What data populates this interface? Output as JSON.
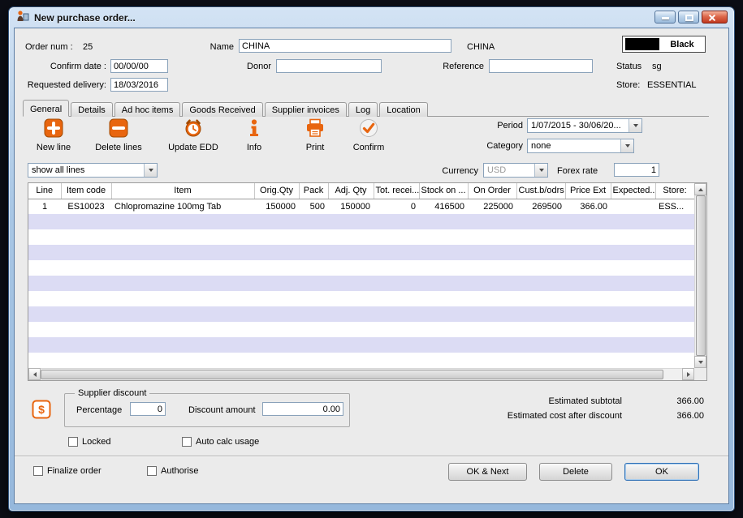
{
  "window": {
    "title": "New purchase order..."
  },
  "header": {
    "order_num_label": "Order num :",
    "order_num_value": "25",
    "name_label": "Name",
    "name_value": "CHINA",
    "name_display": "CHINA",
    "color_label": "Black",
    "confirm_date_label": "Confirm date :",
    "confirm_date_value": "00/00/00",
    "donor_label": "Donor",
    "donor_value": "",
    "reference_label": "Reference",
    "reference_value": "",
    "status_label": "Status",
    "status_value": "sg",
    "requested_delivery_label": "Requested delivery:",
    "requested_delivery_value": "18/03/2016",
    "store_label": "Store:",
    "store_value": "ESSENTIAL"
  },
  "tabs": [
    "General",
    "Details",
    "Ad hoc items",
    "Goods Received",
    "Supplier invoices",
    "Log",
    "Location"
  ],
  "toolbar": {
    "new_line": "New line",
    "delete_lines": "Delete lines",
    "update_edd": "Update EDD",
    "info": "Info",
    "print": "Print",
    "confirm": "Confirm",
    "period_label": "Period",
    "period_value": "1/07/2015 - 30/06/20...",
    "category_label": "Category",
    "category_value": "none"
  },
  "filters": {
    "show_lines_value": "show all lines",
    "currency_label": "Currency",
    "currency_value": "USD",
    "forex_label": "Forex rate",
    "forex_value": "1"
  },
  "table": {
    "columns": [
      "Line",
      "Item code",
      "Item",
      "Orig.Qty",
      "Pack",
      "Adj. Qty",
      "Tot. recei...",
      "Stock on ...",
      "On Order",
      "Cust.b/odrs",
      "Price Ext",
      "Expected...",
      "Store:"
    ],
    "rows": [
      [
        "1",
        "ES10023",
        "Chlopromazine 100mg Tab",
        "150000",
        "500",
        "150000",
        "0",
        "416500",
        "225000",
        "269500",
        "366.00",
        "",
        "ESS..."
      ]
    ],
    "empty_rows": 10
  },
  "footer": {
    "supplier_discount_label": "Supplier discount",
    "percentage_label": "Percentage",
    "percentage_value": "0",
    "discount_amount_label": "Discount amount",
    "discount_amount_value": "0.00",
    "estimated_subtotal_label": "Estimated subtotal",
    "estimated_subtotal_value": "366.00",
    "estimated_cost_label": "Estimated cost after discount",
    "estimated_cost_value": "366.00",
    "locked_label": "Locked",
    "auto_calc_label": "Auto calc usage",
    "finalize_label": "Finalize order",
    "authorise_label": "Authorise",
    "ok_next_label": "OK & Next",
    "delete_label": "Delete",
    "ok_label": "OK"
  },
  "colors": {
    "accent_orange": "#e8650f",
    "row_alt": "#dcdcf4",
    "row_base": "#ffffff"
  }
}
